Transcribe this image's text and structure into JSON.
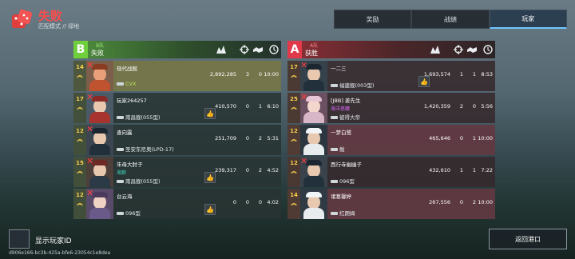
{
  "header": {
    "title": "失败",
    "subtitle": "匹配模式 // 绿地"
  },
  "tabs": [
    {
      "label": "奖励"
    },
    {
      "label": "战绩"
    },
    {
      "label": "玩家"
    }
  ],
  "active_tab": "玩家",
  "team_b": {
    "letter": "B",
    "side": "B队",
    "result": "失败",
    "players": [
      {
        "level": "14",
        "name": "现代战舰",
        "ship": "CVX",
        "damage": "2,892,285",
        "kills": "3",
        "assists": "0",
        "time": "10:00",
        "highlight": true,
        "sunk": true
      },
      {
        "level": "17",
        "name": "玩家264257",
        "ship": "南昌舰(055型)",
        "damage": "410,570",
        "kills": "0",
        "assists": "1",
        "time": "6:10",
        "highlight": false,
        "sunk": true
      },
      {
        "level": "12",
        "name": "查向露",
        "ship": "圣安东尼奥(LPD-17)",
        "damage": "251,709",
        "kills": "0",
        "assists": "2",
        "time": "5:31",
        "highlight": false,
        "sunk": true
      },
      {
        "level": "15",
        "name": "朱母大肘子",
        "tag": "海狼",
        "ship": "南昌舰(055型)",
        "damage": "239,317",
        "kills": "0",
        "assists": "2",
        "time": "4:52",
        "highlight": false,
        "sunk": true
      },
      {
        "level": "12",
        "name": "台云海",
        "ship": "096型",
        "damage": "0",
        "kills": "0",
        "assists": "0",
        "time": "4:02",
        "highlight": false,
        "sunk": true
      }
    ]
  },
  "team_a": {
    "letter": "A",
    "side": "A队",
    "result": "获胜",
    "players": [
      {
        "level": "17",
        "name": "一二三",
        "ship": "福建舰(003型)",
        "damage": "1,693,574",
        "kills": "1",
        "assists": "1",
        "time": "8:53",
        "highlight": false,
        "sunk": true
      },
      {
        "level": "25",
        "name": "[JBB] 姜先生",
        "tag": "海洋恶魔",
        "ship": "彼得大帝",
        "damage": "1,420,359",
        "kills": "2",
        "assists": "0",
        "time": "5:56",
        "highlight": false,
        "sunk": true
      },
      {
        "level": "12",
        "name": "一梦白鹭",
        "ship": "鲅",
        "damage": "465,646",
        "kills": "0",
        "assists": "1",
        "time": "10:00",
        "highlight": true,
        "sunk": false
      },
      {
        "level": "12",
        "name": "西行寺幽幽子",
        "ship": "096型",
        "damage": "432,610",
        "kills": "1",
        "assists": "1",
        "time": "7:22",
        "highlight": false,
        "sunk": true
      },
      {
        "level": "14",
        "name": "诸葛馨婷",
        "ship": "红朗姆",
        "damage": "267,556",
        "kills": "0",
        "assists": "2",
        "time": "10:00",
        "highlight": true,
        "sunk": false
      }
    ]
  },
  "footer": {
    "show_id_label": "显示玩家ID",
    "uid": "d906e166-bc3b-425a-bfe6-23054c1e8dea",
    "return_label": "返回港口"
  },
  "colors": {
    "defeat": "#ff4b4b",
    "team_b": "#6fcf3c",
    "team_a": "#e0394a",
    "active_tab_accent": "#6ec6ff",
    "level": "#ffd24a"
  },
  "icons": {
    "header": "dice-icon",
    "stat_columns": [
      "damage-icon",
      "kills-icon",
      "assists-icon",
      "survival-time-icon"
    ],
    "row": [
      "sunk-x-icon",
      "ship-class-icon",
      "like-thumb-icon",
      "rank-chevron-icon"
    ]
  }
}
